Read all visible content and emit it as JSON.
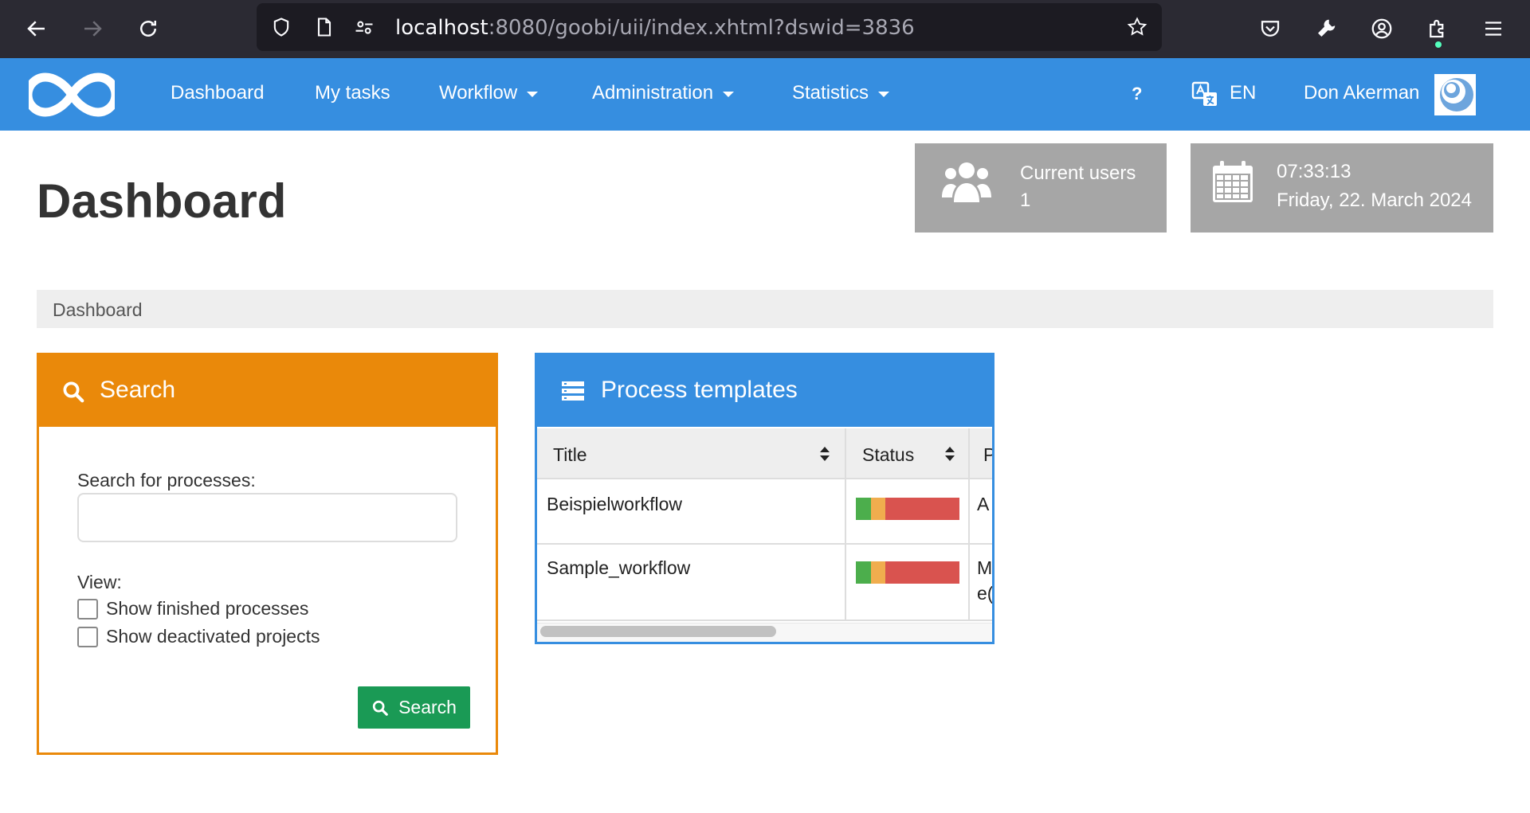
{
  "browser": {
    "url_host": "localhost",
    "url_rest": ":8080/goobi/uii/index.xhtml?dswid=3836"
  },
  "nav": {
    "items": [
      {
        "label": "Dashboard",
        "dropdown": false
      },
      {
        "label": "My tasks",
        "dropdown": false
      },
      {
        "label": "Workflow",
        "dropdown": true
      },
      {
        "label": "Administration",
        "dropdown": true
      },
      {
        "label": "Statistics",
        "dropdown": true
      }
    ],
    "help": "?",
    "language": "EN",
    "user": "Don Akerman",
    "accent_color": "#368ee0"
  },
  "header": {
    "title": "Dashboard",
    "current_users_label": "Current users",
    "current_users_count": "1",
    "time": "07:33:13",
    "date": "Friday, 22. March 2024"
  },
  "breadcrumb": "Dashboard",
  "search_panel": {
    "title": "Search",
    "field_label": "Search for processes:",
    "input_value": "",
    "view_label": "View:",
    "options": [
      {
        "label": "Show finished processes",
        "checked": false
      },
      {
        "label": "Show deactivated projects",
        "checked": false
      }
    ],
    "button_label": "Search",
    "header_color": "#ea890a",
    "button_color": "#1a9a55"
  },
  "templates_panel": {
    "title": "Process templates",
    "columns": [
      "Title",
      "Status",
      "P"
    ],
    "rows": [
      {
        "title": "Beispielworkflow",
        "third": "A"
      },
      {
        "title": "Sample_workflow",
        "third": "M"
      }
    ],
    "row2_third_line2": "e("
  }
}
